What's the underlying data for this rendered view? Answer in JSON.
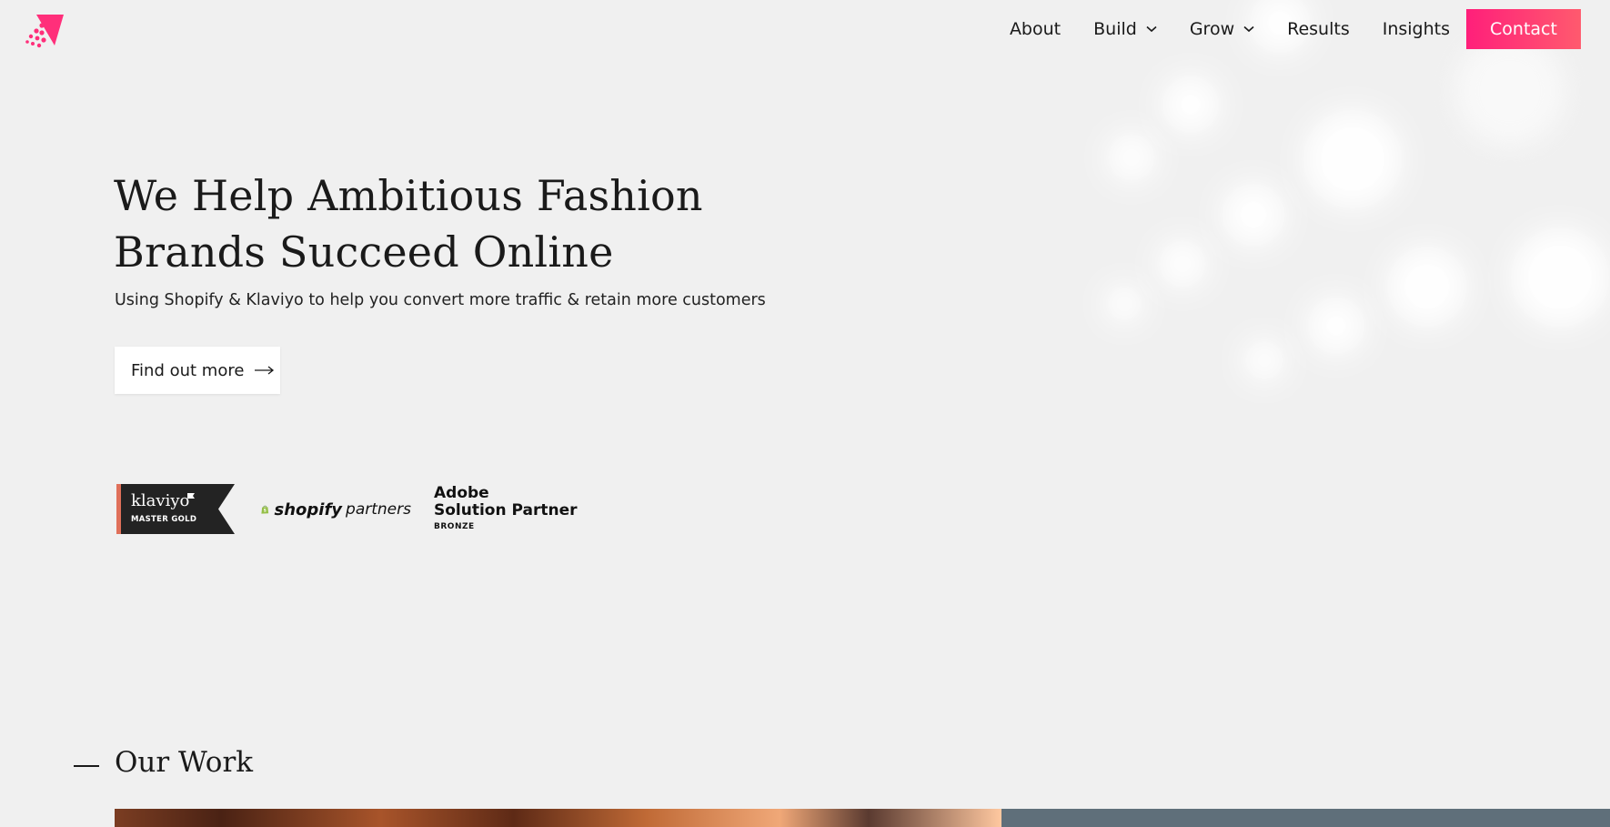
{
  "nav": {
    "items": [
      {
        "label": "About",
        "dropdown": false
      },
      {
        "label": "Build",
        "dropdown": true
      },
      {
        "label": "Grow",
        "dropdown": true
      },
      {
        "label": "Results",
        "dropdown": false
      },
      {
        "label": "Insights",
        "dropdown": false
      }
    ],
    "contact_label": "Contact"
  },
  "hero": {
    "title_line1": "We Help Ambitious Fashion",
    "title_line2": "Brands Succeed Online",
    "subtitle": "Using Shopify & Klaviyo to help you convert more traffic & retain more customers",
    "cta_label": "Find out more"
  },
  "badges": {
    "klaviyo_name": "klaviyo",
    "klaviyo_tier": "MASTER GOLD",
    "shopify_word1": "shopify",
    "shopify_word2": "partners",
    "adobe_line1": "Adobe",
    "adobe_line2": "Solution Partner",
    "adobe_line3": "BRONZE"
  },
  "work": {
    "title": "Our Work"
  },
  "colors": {
    "accent_start": "#ff1f7a",
    "accent_end": "#ff5a6e",
    "background": "#f0f0f0",
    "text": "#1a1a1a"
  }
}
